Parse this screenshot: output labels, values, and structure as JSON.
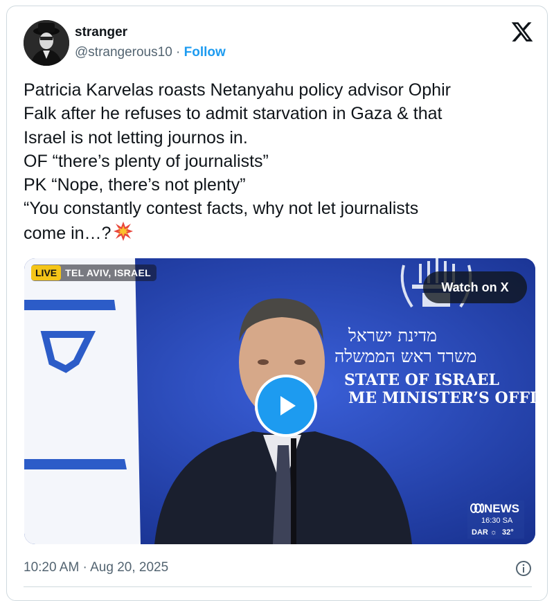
{
  "author": {
    "display_name": "stranger",
    "handle": "@strangerous10",
    "separator": " · ",
    "follow_label": "Follow"
  },
  "tweet": {
    "lines": [
      "Patricia Karvelas roasts Netanyahu policy advisor Ophir",
      "Falk after he refuses to admit starvation in Gaza & that",
      "Israel is not letting journos in.",
      "OF “there’s plenty of journalists”",
      "PK “Nope, there’s not plenty”",
      "“You constantly contest facts, why not let journalists",
      "come in…?"
    ],
    "emoji_icon": "collision-emoji"
  },
  "video": {
    "live_label": "LIVE",
    "location": "TEL AVIV, ISRAEL",
    "watch_label": "Watch on X",
    "backdrop_hebrew_line1": "מדינת ישראל",
    "backdrop_hebrew_line2": "משרד ראש הממשלה",
    "backdrop_english_line1": "STATE OF ISRAEL",
    "backdrop_english_line2": "ME MINISTER’S OFFICE",
    "network_name": "NEWS",
    "network_time": "16:30 SA",
    "weather_label": "DAR",
    "temperature": "32°"
  },
  "footer": {
    "timestamp": "10:20 AM · Aug 20, 2025"
  },
  "colors": {
    "accent": "#1d9bf0",
    "text": "#0f1419",
    "muted": "#536471",
    "border": "#cfd9de",
    "video_bg": "#1f3fae"
  }
}
